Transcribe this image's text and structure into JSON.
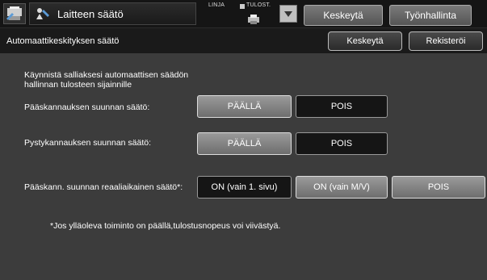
{
  "header": {
    "title": "Laitteen säätö",
    "linja_label": "LINJA",
    "tulost_label": "TULOST.",
    "pause_label": "Keskeytä",
    "job_label": "Työnhallinta"
  },
  "subheader": {
    "title": "Automaattikeskityksen säätö",
    "cancel_label": "Keskeytä",
    "register_label": "Rekisteröi"
  },
  "content": {
    "intro_line1": "Käynnistä salliaksesi automaattisen säädön",
    "intro_line2": "hallinnan tulosteen sijainnille",
    "rows": [
      {
        "label": "Pääskannauksen suunnan säätö:",
        "on": "PÄÄLLÄ",
        "off": "POIS"
      },
      {
        "label": "Pystykannauksen suunnan säätö:",
        "on": "PÄÄLLÄ",
        "off": "POIS"
      },
      {
        "label": "Pääskann. suunnan reaaliaikainen säätö*:",
        "opt1": "ON (vain 1. sivu)",
        "opt2": "ON (vain M/V)",
        "opt3": "POIS"
      }
    ],
    "footnote": "*Jos ylläoleva toiminto on päällä,tulostusnopeus voi viivästyä."
  },
  "colors": {
    "bg": "#3c3c3c",
    "header": "#151515",
    "selected": "#151515"
  }
}
